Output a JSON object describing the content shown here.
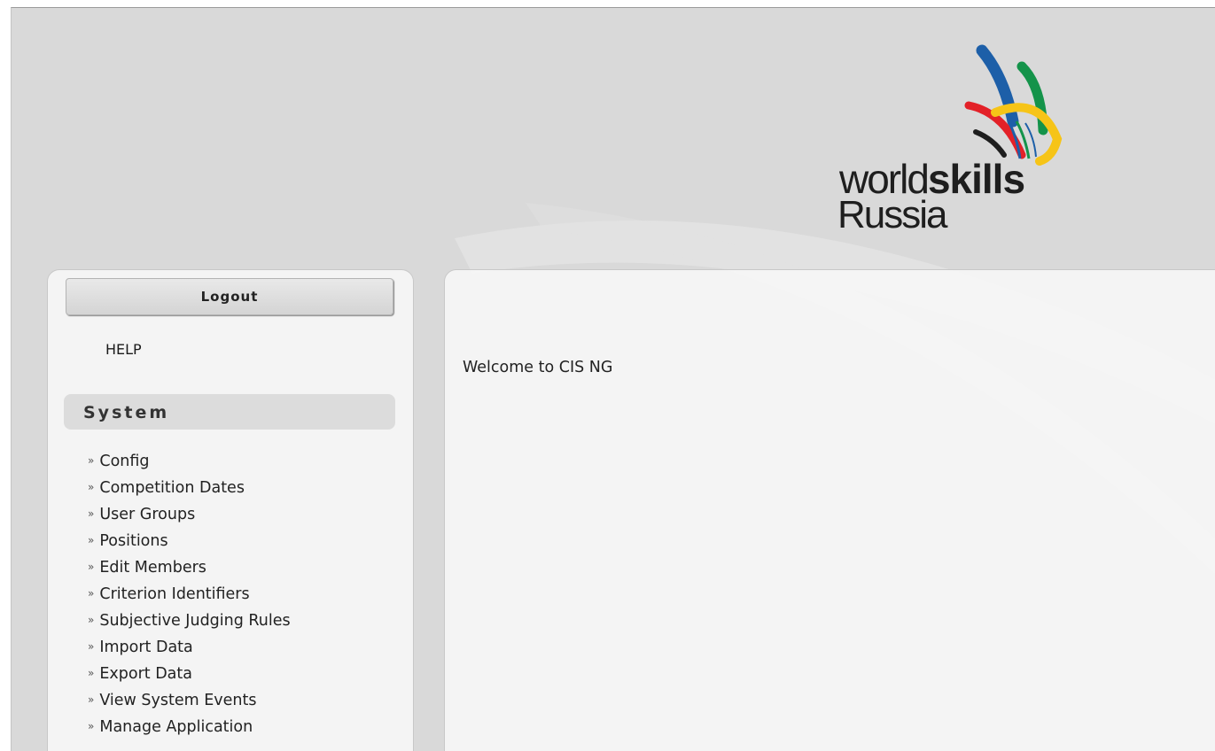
{
  "header": {
    "logo": {
      "word_world": "world",
      "word_skills": "skills",
      "word_russia": "Russia",
      "colors": {
        "blue": "#1d5fa8",
        "green": "#14934a",
        "red": "#e32128",
        "yellow": "#f6c417",
        "black": "#1e1e1e"
      }
    }
  },
  "sidebar": {
    "logout_label": "Logout",
    "help_label": "HELP",
    "section_title": "System",
    "items": [
      {
        "label": "Config"
      },
      {
        "label": "Competition Dates"
      },
      {
        "label": "User Groups"
      },
      {
        "label": "Positions"
      },
      {
        "label": "Edit Members"
      },
      {
        "label": "Criterion Identifiers"
      },
      {
        "label": "Subjective Judging Rules"
      },
      {
        "label": "Import Data"
      },
      {
        "label": "Export Data"
      },
      {
        "label": "View System Events"
      },
      {
        "label": "Manage Application"
      }
    ]
  },
  "main": {
    "welcome_text": "Welcome to CIS NG"
  }
}
